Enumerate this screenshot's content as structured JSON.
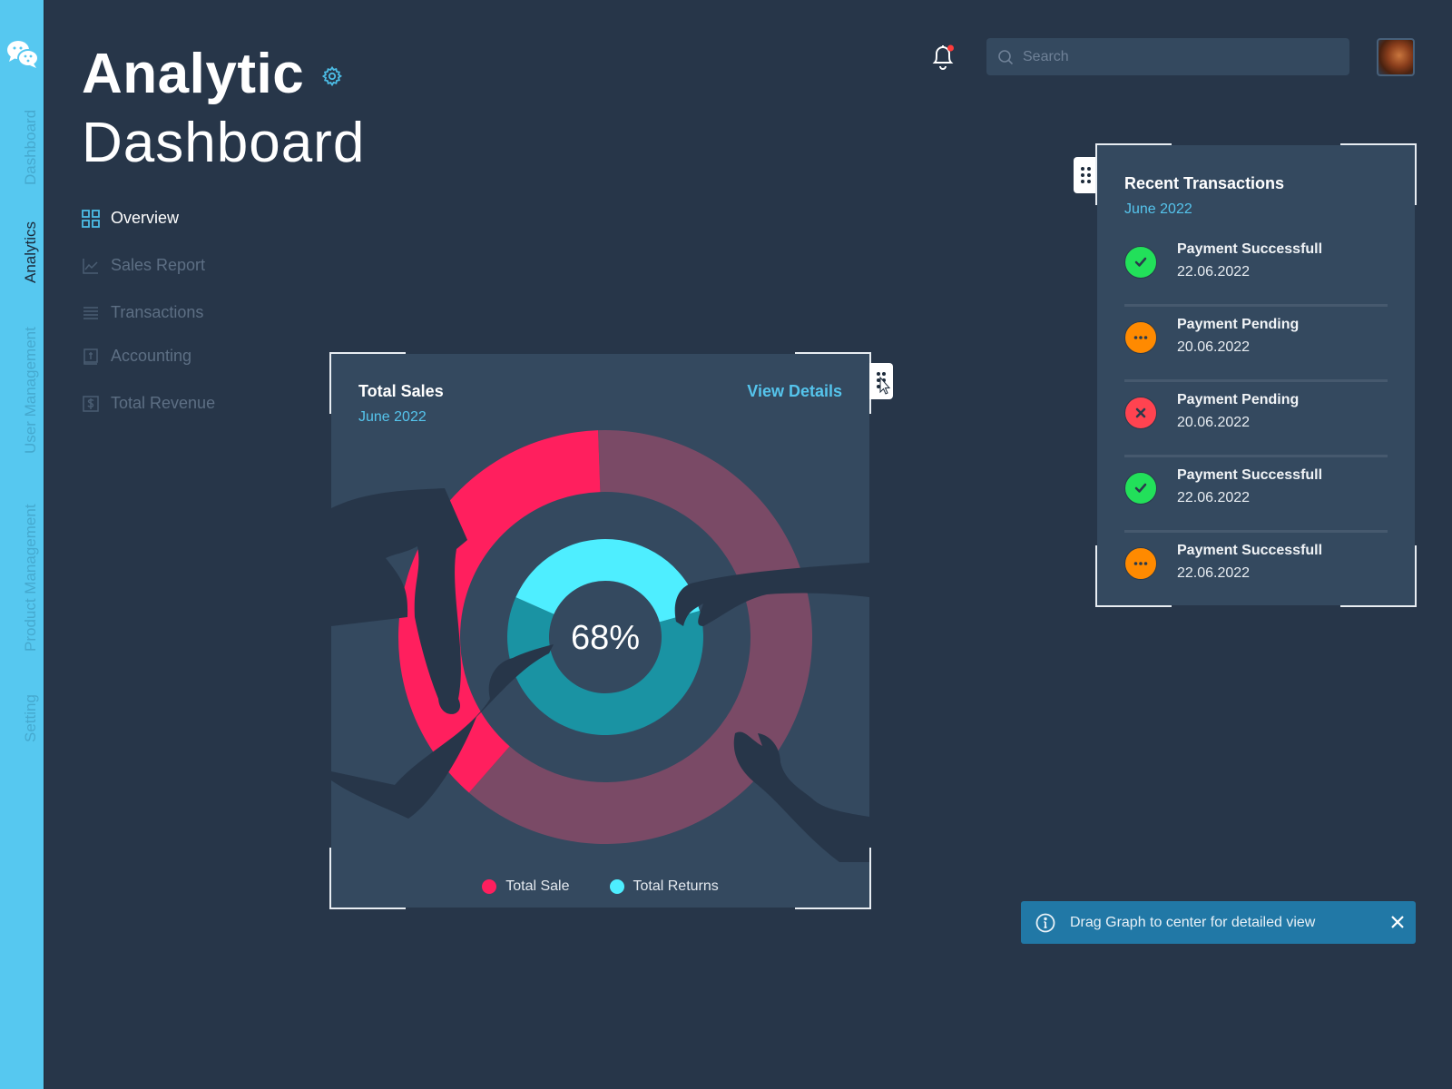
{
  "rail": {
    "items": [
      {
        "label": "Dashboard",
        "active": false
      },
      {
        "label": "Analytics",
        "active": true
      },
      {
        "label": "User Management",
        "active": false
      },
      {
        "label": "Product Management",
        "active": false
      },
      {
        "label": "Setting",
        "active": false
      }
    ],
    "logo_icon": "chat-bubbles-icon"
  },
  "header": {
    "title_line1": "Analytic",
    "title_line2": "Dashboard",
    "settings_icon": "gear-icon"
  },
  "nav": {
    "items": [
      {
        "label": "Overview",
        "icon": "grid-icon",
        "active": true
      },
      {
        "label": "Sales Report",
        "icon": "line-chart-icon",
        "active": false
      },
      {
        "label": "Transactions",
        "icon": "list-icon",
        "active": false
      },
      {
        "label": "Accounting",
        "icon": "ledger-icon",
        "active": false
      },
      {
        "label": "Total Revenue",
        "icon": "dollar-icon",
        "active": false
      }
    ]
  },
  "topbar": {
    "search_placeholder": "Search",
    "search_value": "",
    "notification_dot": true
  },
  "sales_card": {
    "title": "Total Sales",
    "subtitle": "June 2022",
    "view_details": "View Details",
    "center_label": "68%",
    "legend": [
      {
        "label": "Total Sale",
        "color": "#ff1f5e"
      },
      {
        "label": "Total Returns",
        "color": "#4eeeff"
      }
    ]
  },
  "chart_data": {
    "type": "pie",
    "title": "Total Sales",
    "subtitle": "June 2022",
    "center_value": "68%",
    "rings": [
      {
        "name": "Total Sale",
        "ring": "outer",
        "highlight_fraction": 0.38,
        "highlight_color": "#ff1f5e",
        "remainder_color": "#7a4a66"
      },
      {
        "name": "Total Returns",
        "ring": "inner",
        "highlight_fraction": 0.39,
        "highlight_color": "#4eeeff",
        "remainder_color": "#1a93a3"
      }
    ],
    "legend": [
      "Total Sale",
      "Total Returns"
    ],
    "legend_position": "bottom"
  },
  "transactions": {
    "title": "Recent Transactions",
    "subtitle": "June 2022",
    "items": [
      {
        "status": "success",
        "name": "Payment Successfull",
        "date": "22.06.2022"
      },
      {
        "status": "pending",
        "name": "Payment Pending",
        "date": "20.06.2022"
      },
      {
        "status": "failed",
        "name": "Payment Pending",
        "date": "20.06.2022"
      },
      {
        "status": "success",
        "name": "Payment Successfull",
        "date": "22.06.2022"
      },
      {
        "status": "pending",
        "name": "Payment Successfull",
        "date": "22.06.2022"
      }
    ]
  },
  "status_colors": {
    "success": "#22e05a",
    "pending": "#ff8a00",
    "failed": "#ff4350"
  },
  "toast": {
    "message": "Drag Graph to center for detailed view"
  },
  "colors": {
    "background": "#273649",
    "card": "#34495f",
    "rail": "#56c8f0",
    "accent": "#55c4ec"
  }
}
